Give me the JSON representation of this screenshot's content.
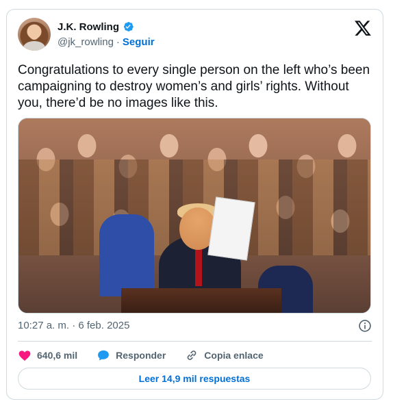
{
  "author": {
    "name": "J.K. Rowling",
    "handle": "@jk_rowling",
    "separator": "·",
    "follow_label": "Seguir",
    "verified": true
  },
  "brand": {
    "logo_icon": "x-logo-icon"
  },
  "tweet": {
    "text": "Congratulations to every single person on the left who’s been campaigning to destroy women’s and girls’ rights. Without you, there’d be no images like this."
  },
  "meta": {
    "timestamp": "10:27 a. m. · 6 feb. 2025",
    "info_icon": "info-icon"
  },
  "actions": {
    "likes": {
      "icon": "heart-icon",
      "label": "640,6 mil",
      "color": "#f91880"
    },
    "reply": {
      "icon": "reply-bubble-icon",
      "label": "Responder",
      "color": "#1d9bf0"
    },
    "copy_link": {
      "icon": "link-icon",
      "label": "Copia enlace"
    }
  },
  "read_replies_label": "Leer 14,9 mil respuestas",
  "colors": {
    "accent": "#006fd6",
    "border": "#cfd9de",
    "secondary_text": "#536471",
    "like": "#f91880",
    "verified": "#1d9bf0"
  }
}
